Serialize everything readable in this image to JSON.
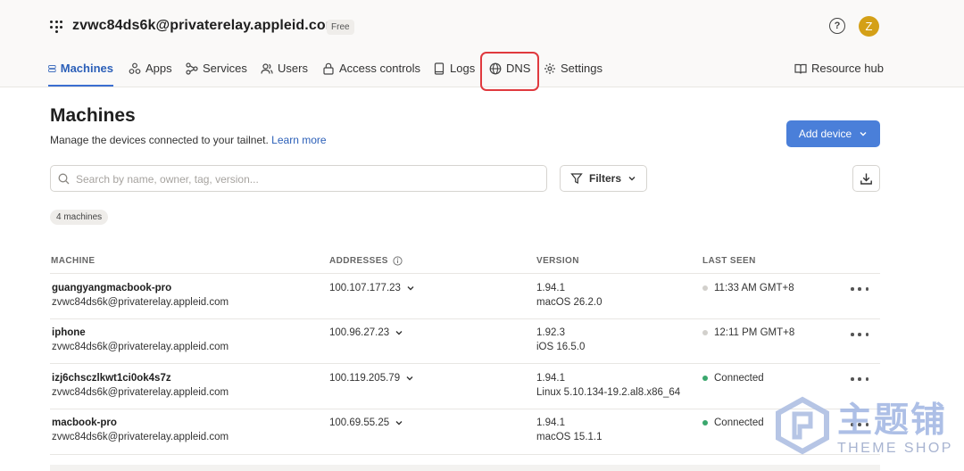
{
  "header": {
    "account": "zvwc84ds6k@privaterelay.appleid.com",
    "plan": "Free",
    "help_icon": "question-circle-icon",
    "avatar_letter": "Z",
    "avatar_color": "#d4a017"
  },
  "nav": {
    "tabs": [
      {
        "label": "Machines",
        "icon": "server-icon",
        "active": true
      },
      {
        "label": "Apps",
        "icon": "apps-icon"
      },
      {
        "label": "Services",
        "icon": "services-icon"
      },
      {
        "label": "Users",
        "icon": "users-icon"
      },
      {
        "label": "Access controls",
        "icon": "lock-icon"
      },
      {
        "label": "Logs",
        "icon": "document-icon"
      },
      {
        "label": "DNS",
        "icon": "globe-icon",
        "highlighted": true
      },
      {
        "label": "Settings",
        "icon": "gear-icon"
      }
    ],
    "resource_hub": "Resource hub"
  },
  "page": {
    "title": "Machines",
    "subtitle": "Manage the devices connected to your tailnet.",
    "learn_more": "Learn more",
    "add_device": "Add device",
    "search_placeholder": "Search by name, owner, tag, version...",
    "filters": "Filters",
    "machine_count": "4 machines"
  },
  "table": {
    "headers": {
      "machine": "MACHINE",
      "addresses": "ADDRESSES",
      "version": "VERSION",
      "last_seen": "LAST SEEN"
    },
    "rows": [
      {
        "name": "guangyangmacbook-pro",
        "owner": "zvwc84ds6k@privaterelay.appleid.com",
        "address": "100.107.177.23",
        "version": "1.94.1",
        "os": "macOS 26.2.0",
        "last_seen": "11:33 AM GMT+8",
        "connected": false
      },
      {
        "name": "iphone",
        "owner": "zvwc84ds6k@privaterelay.appleid.com",
        "address": "100.96.27.23",
        "version": "1.92.3",
        "os": "iOS 16.5.0",
        "last_seen": "12:11 PM GMT+8",
        "connected": false
      },
      {
        "name": "izj6chsczlkwt1ci0ok4s7z",
        "owner": "zvwc84ds6k@privaterelay.appleid.com",
        "address": "100.119.205.79",
        "version": "1.94.1",
        "os": "Linux 5.10.134-19.2.al8.x86_64",
        "last_seen": "Connected",
        "connected": true
      },
      {
        "name": "macbook-pro",
        "owner": "zvwc84ds6k@privaterelay.appleid.com",
        "address": "100.69.55.25",
        "version": "1.94.1",
        "os": "macOS 15.1.1",
        "last_seen": "Connected",
        "connected": true
      }
    ]
  },
  "colors": {
    "accent": "#4a7fd9",
    "active_tab": "#2b5fb8",
    "highlight": "#e0393e",
    "connected": "#3aa76d"
  },
  "watermark": {
    "text_cn": "主题铺",
    "text_en": "THEME SHOP"
  }
}
